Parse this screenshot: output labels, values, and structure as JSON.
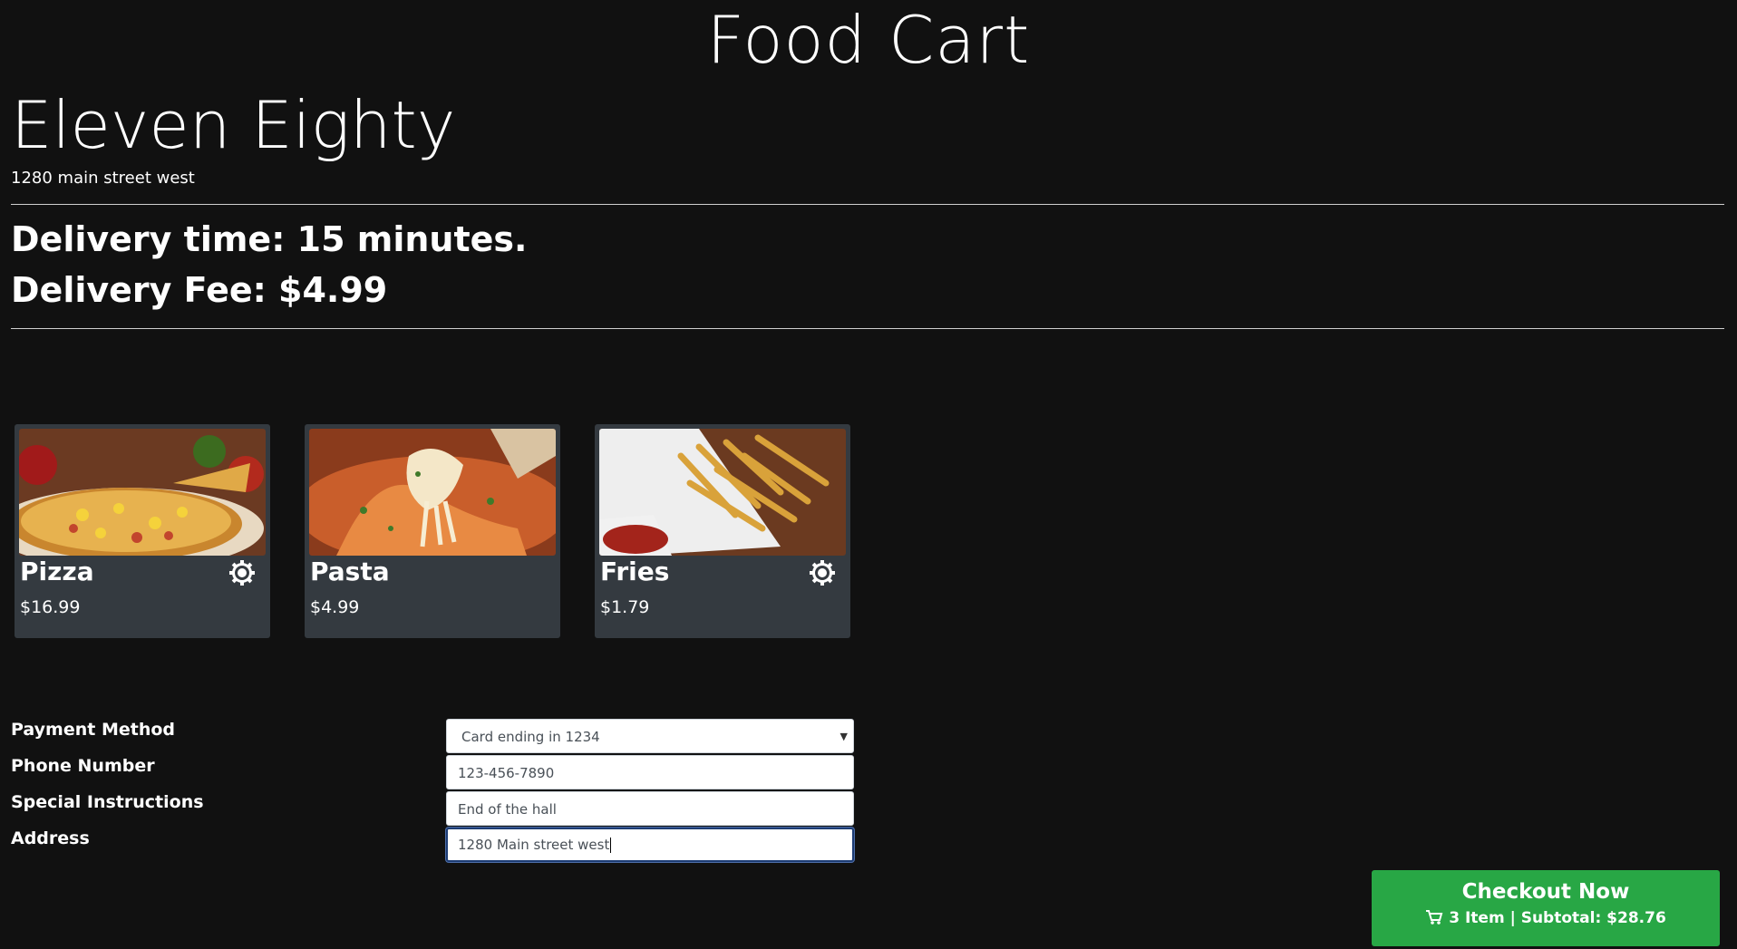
{
  "app_title": "Food Cart",
  "restaurant": {
    "name": "Eleven Eighty",
    "address": "1280 main street west"
  },
  "delivery": {
    "time_text": "Delivery time: 15 minutes.",
    "fee_text": "Delivery Fee: $4.99"
  },
  "items": [
    {
      "name": "Pizza",
      "price": "$16.99",
      "has_options": true,
      "image": "pizza-photo"
    },
    {
      "name": "Pasta",
      "price": "$4.99",
      "has_options": false,
      "image": "pasta-photo"
    },
    {
      "name": "Fries",
      "price": "$1.79",
      "has_options": true,
      "image": "fries-photo"
    }
  ],
  "form": {
    "payment_label": "Payment Method",
    "payment_value": "Card ending in 1234",
    "phone_label": "Phone Number",
    "phone_value": "123-456-7890",
    "instructions_label": "Special Instructions",
    "instructions_value": "End of the hall",
    "address_label": "Address",
    "address_value": "1280 Main street west"
  },
  "checkout": {
    "title": "Checkout Now",
    "summary": "3 Item | Subtotal: $28.76"
  },
  "colors": {
    "background": "#111111",
    "card": "#343a40",
    "checkout": "#28a745"
  }
}
